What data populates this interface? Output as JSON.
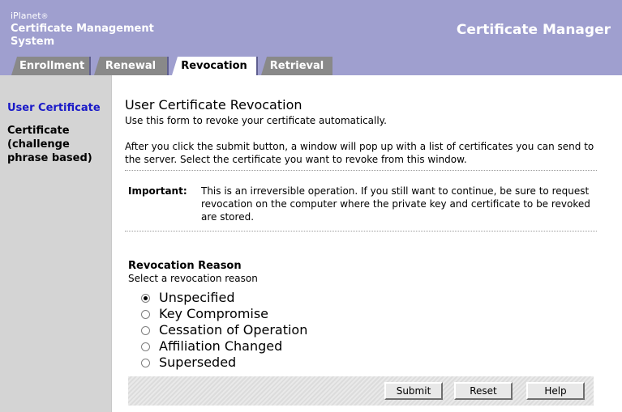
{
  "header": {
    "brand_top": "iPlanet",
    "brand_reg": "®",
    "brand_line1": "Certificate Management",
    "brand_line2": "System",
    "app_title": "Certificate Manager",
    "colors": {
      "header_bg": "#9f9fcf",
      "tab_inactive": "#898989",
      "sidebar_bg": "#d4d4d4",
      "link": "#1a1ac8"
    }
  },
  "tabs": [
    {
      "label": "Enrollment",
      "active": false
    },
    {
      "label": "Renewal",
      "active": false
    },
    {
      "label": "Revocation",
      "active": true
    },
    {
      "label": "Retrieval",
      "active": false
    }
  ],
  "sidebar": {
    "items": [
      {
        "label": "User Certificate",
        "active": true
      },
      {
        "label": "Certificate (challenge phrase based)",
        "active": false
      }
    ]
  },
  "main": {
    "title": "User Certificate Revocation",
    "intro": "Use this form to revoke your certificate automatically.",
    "instructions": "After you click the submit button, a window will pop up with a list of certificates you can send to the server. Select the certificate you want to revoke from this window.",
    "important_label": "Important:",
    "important_text": "This is an irreversible operation. If you still want to continue, be sure to request revocation on the computer where the private key and certificate to be revoked are stored.",
    "reason_heading": "Revocation Reason",
    "reason_sub": "Select a revocation reason",
    "reasons": [
      {
        "label": "Unspecified",
        "selected": true
      },
      {
        "label": "Key Compromise",
        "selected": false
      },
      {
        "label": "Cessation of Operation",
        "selected": false
      },
      {
        "label": "Affiliation Changed",
        "selected": false
      },
      {
        "label": "Superseded",
        "selected": false
      }
    ]
  },
  "buttons": {
    "submit": "Submit",
    "reset": "Reset",
    "help": "Help"
  }
}
